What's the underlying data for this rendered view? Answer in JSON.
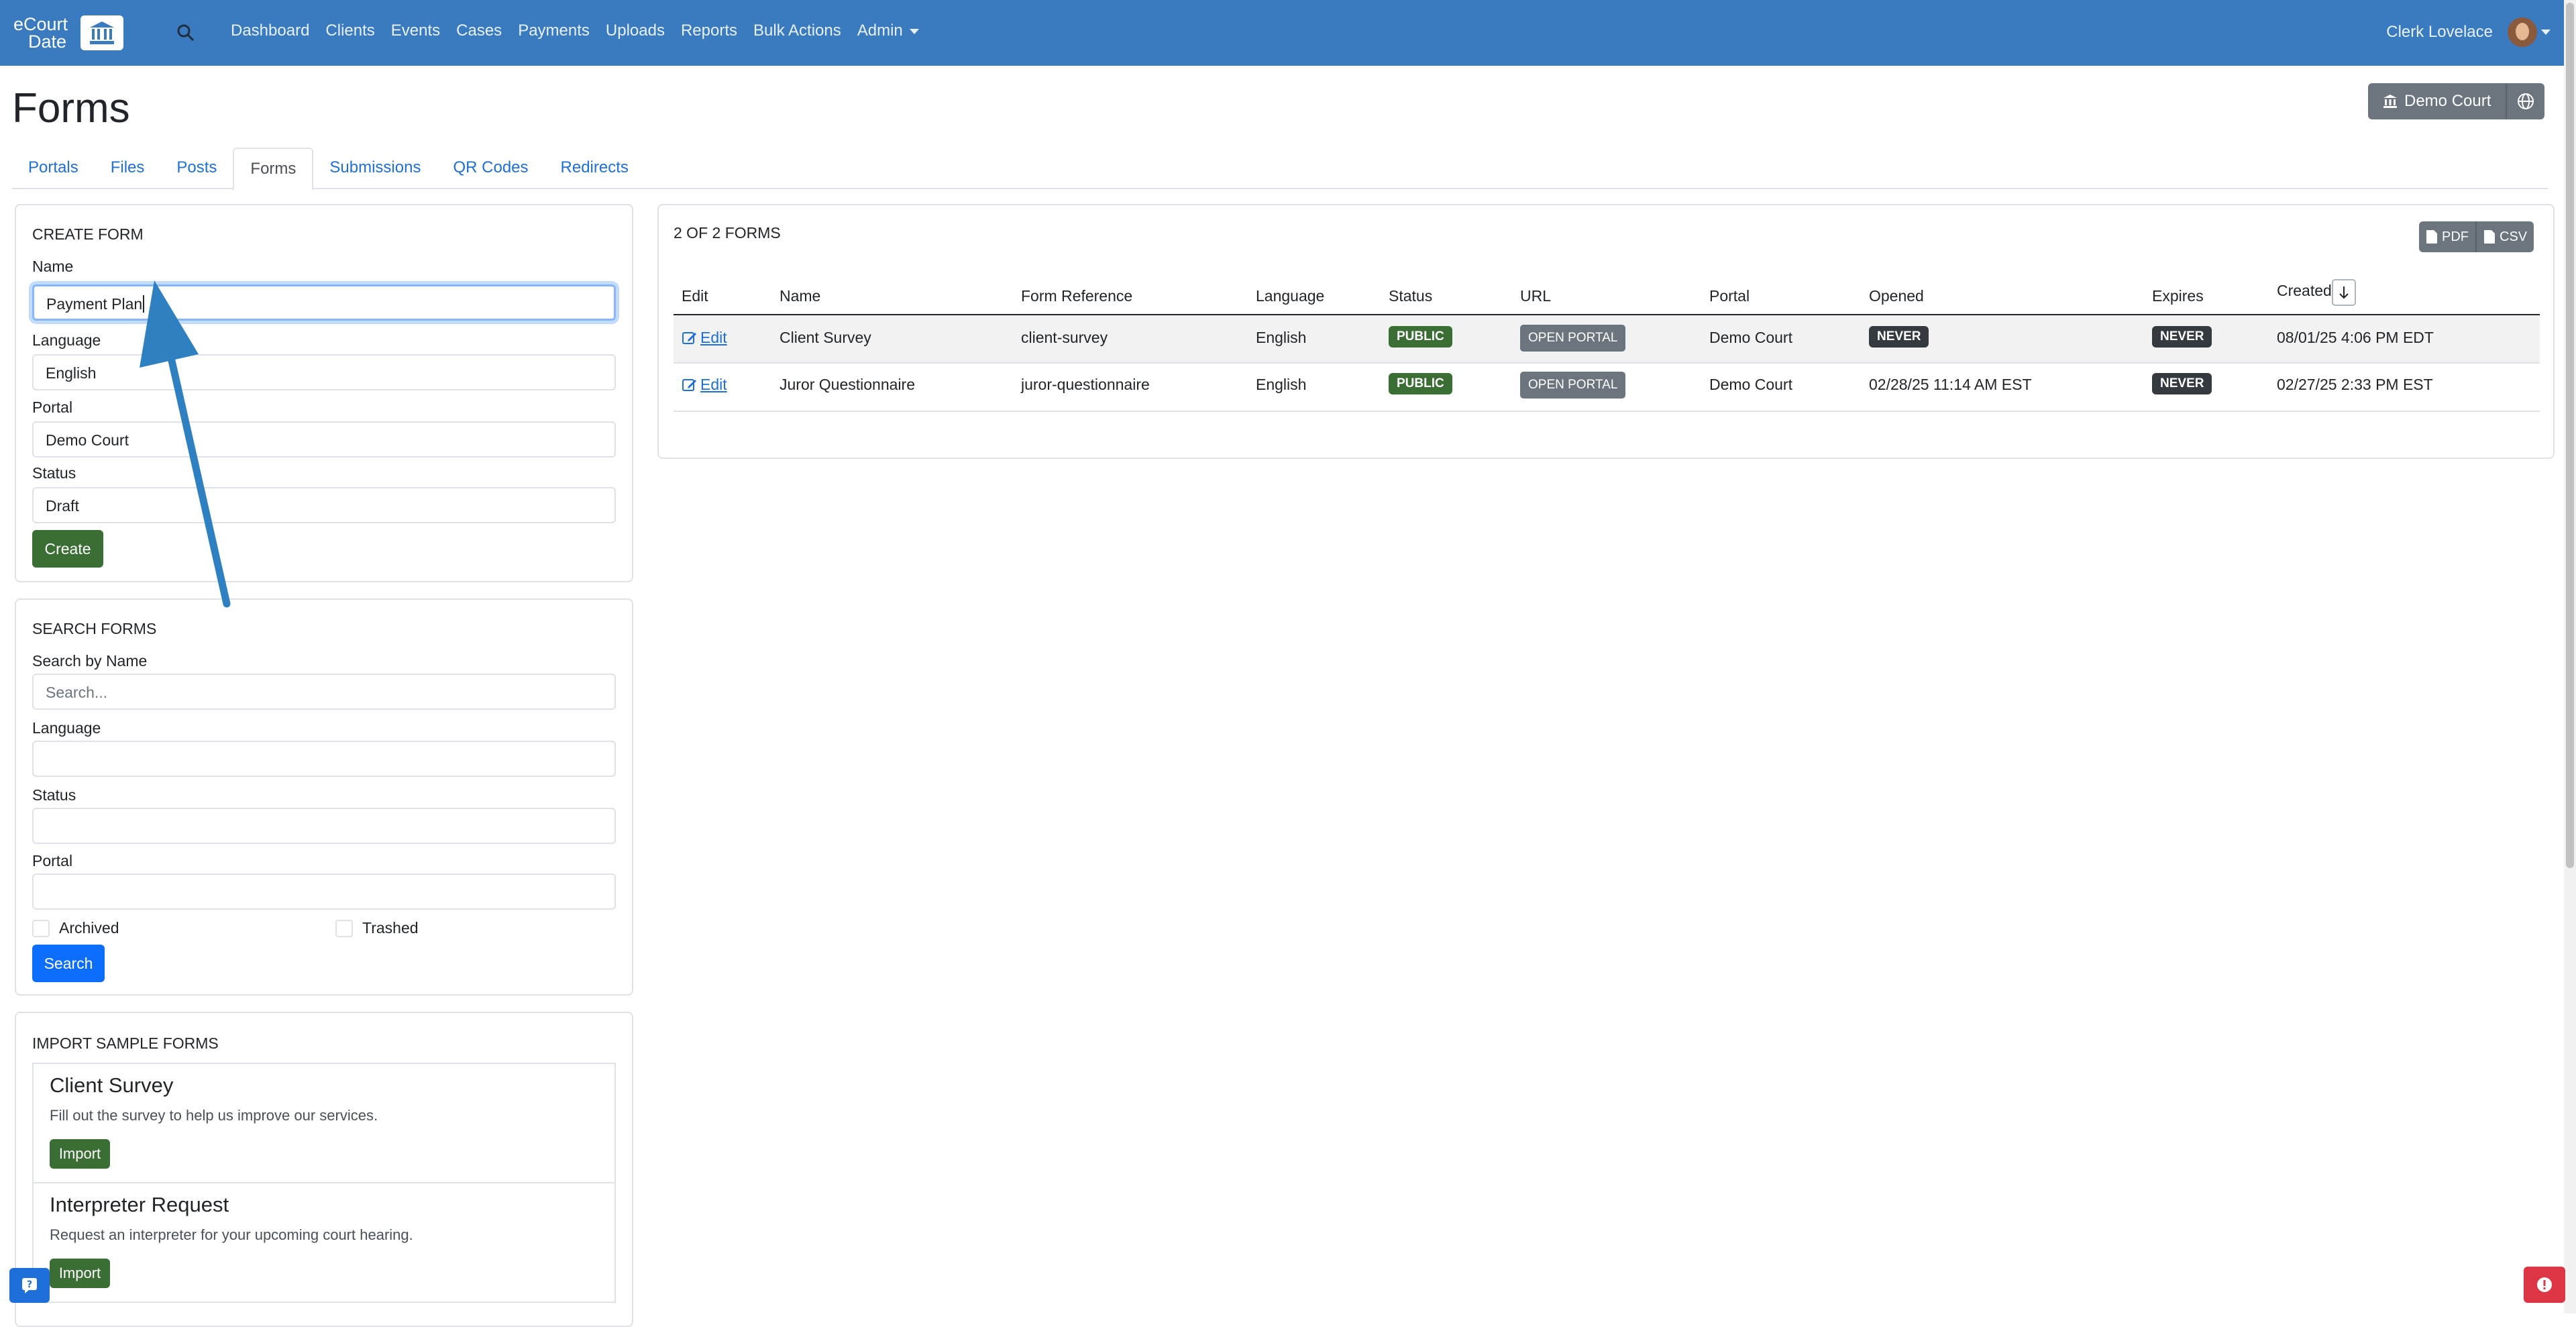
{
  "nav": {
    "logo": {
      "line1": "eCourt",
      "line2": "Date"
    },
    "links": [
      "Dashboard",
      "Clients",
      "Events",
      "Cases",
      "Payments",
      "Uploads",
      "Reports",
      "Bulk Actions",
      "Admin"
    ],
    "user_name": "Clerk Lovelace"
  },
  "page": {
    "title": "Forms"
  },
  "court_button": "Demo Court",
  "tabs": [
    "Portals",
    "Files",
    "Posts",
    "Forms",
    "Submissions",
    "QR Codes",
    "Redirects"
  ],
  "create_form": {
    "title": "CREATE FORM",
    "name_label": "Name",
    "name_value": "Payment Plan",
    "language_label": "Language",
    "language_value": "English",
    "portal_label": "Portal",
    "portal_value": "Demo Court",
    "status_label": "Status",
    "status_value": "Draft",
    "create_button": "Create"
  },
  "search_forms": {
    "title": "SEARCH FORMS",
    "name_label": "Search by Name",
    "name_placeholder": "Search...",
    "language_label": "Language",
    "status_label": "Status",
    "portal_label": "Portal",
    "archived_label": "Archived",
    "trashed_label": "Trashed",
    "search_button": "Search"
  },
  "import_samples": {
    "title": "IMPORT SAMPLE FORMS",
    "items": [
      {
        "title": "Client Survey",
        "description": "Fill out the survey to help us improve our services.",
        "button": "Import"
      },
      {
        "title": "Interpreter Request",
        "description": "Request an interpreter for your upcoming court hearing.",
        "button": "Import"
      }
    ]
  },
  "forms_table": {
    "count_label": "2 OF 2 FORMS",
    "export": {
      "pdf": "PDF",
      "csv": "CSV"
    },
    "headers": [
      "Edit",
      "Name",
      "Form Reference",
      "Language",
      "Status",
      "URL",
      "Portal",
      "Opened",
      "Expires",
      "Created"
    ],
    "rows": [
      {
        "edit": "Edit",
        "name": "Client Survey",
        "reference": "client-survey",
        "language": "English",
        "status": "PUBLIC",
        "url": "OPEN PORTAL",
        "portal": "Demo Court",
        "opened": "NEVER",
        "expires": "NEVER",
        "created": "08/01/25 4:06 PM EDT"
      },
      {
        "edit": "Edit",
        "name": "Juror Questionnaire",
        "reference": "juror-questionnaire",
        "language": "English",
        "status": "PUBLIC",
        "url": "OPEN PORTAL",
        "portal": "Demo Court",
        "opened": "02/28/25 11:14 AM EST",
        "expires": "NEVER",
        "created": "02/27/25 2:33 PM EST"
      }
    ]
  },
  "colors": {
    "navbar": "#3a7bbf",
    "primary": "#0d6efd",
    "success": "#3a6e34",
    "annotation_arrow": "#2f80c0"
  }
}
